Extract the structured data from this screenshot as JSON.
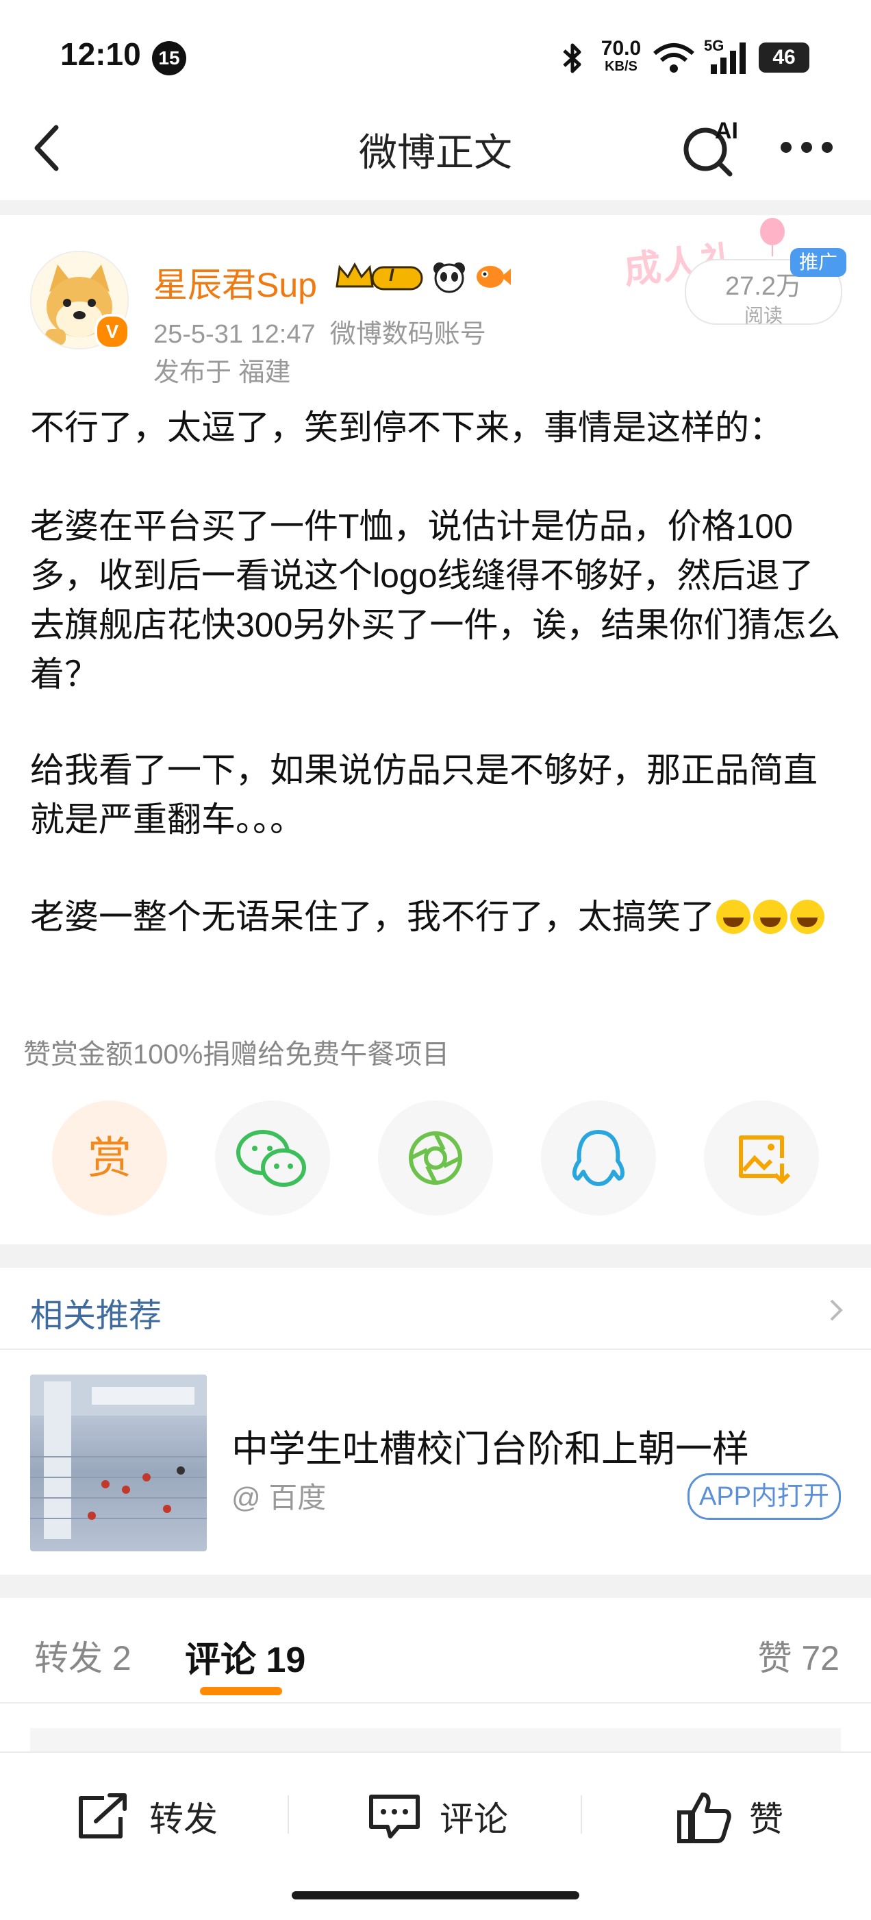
{
  "status_bar": {
    "time": "12:10",
    "notif_count": "15",
    "net_speed": "70.0",
    "net_unit": "KB/S",
    "signal_label": "5G",
    "battery": "46"
  },
  "header": {
    "title": "微博正文",
    "ai_label": "AI"
  },
  "author": {
    "name": "星辰君Sup",
    "verified_badge": "V",
    "rank_badge": "I",
    "timestamp": "25-5-31 12:47",
    "source": "微博数码账号",
    "location": "发布于 福建"
  },
  "stats_pill": {
    "count": "27.2万",
    "label": "阅读"
  },
  "promo": {
    "tag": "推广",
    "banner": "成人礼"
  },
  "post": {
    "p1": "不行了，太逗了，笑到停不下来，事情是这样的：",
    "p2": "老婆在平台买了一件T恤，说估计是仿品，价格100多，收到后一看说这个logo线缝得不够好，然后退了去旗舰店花快300另外买了一件，诶，结果你们猜怎么着？",
    "p3": "给我看了一下，如果说仿品只是不够好，那正品简直就是严重翻车。。。",
    "p4": "老婆一整个无语呆住了，我不行了，太搞笑了"
  },
  "reward": {
    "note": "赞赏金额100%捐赠给免费午餐项目",
    "button_label": "赏"
  },
  "related": {
    "title": "相关推荐",
    "headline": "中学生吐槽校门台阶和上朝一样",
    "source": "@ 百度",
    "open_label": "APP内打开"
  },
  "tabs": {
    "repost": "转发 2",
    "comment": "评论 19",
    "like": "赞 72"
  },
  "bottom_bar": {
    "repost": "转发",
    "comment": "评论",
    "like": "赞"
  },
  "colors": {
    "accent": "#ff8a00",
    "author_name": "#f07a12",
    "link_blue": "#3f6c9c",
    "muted": "#999999"
  }
}
